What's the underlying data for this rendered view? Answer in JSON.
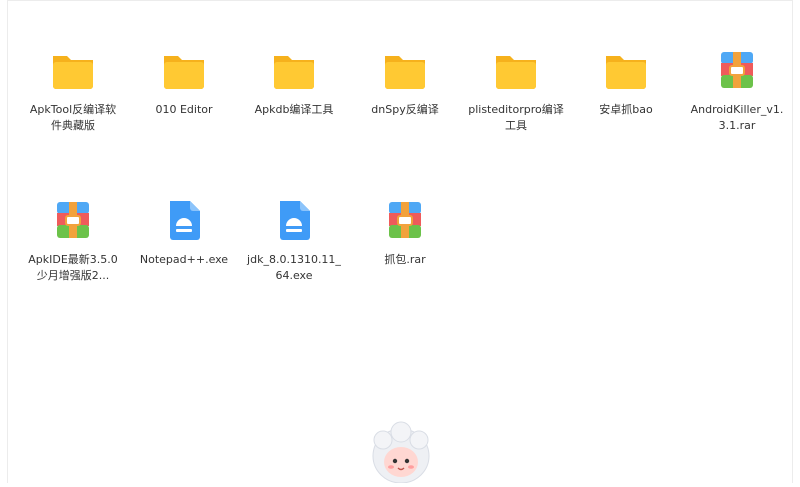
{
  "files": [
    {
      "name": "ApkTool反编译软件典藏版",
      "type": "folder"
    },
    {
      "name": "010 Editor",
      "type": "folder"
    },
    {
      "name": "Apkdb编译工具",
      "type": "folder"
    },
    {
      "name": "dnSpy反编译",
      "type": "folder"
    },
    {
      "name": "plisteditorpro编译工具",
      "type": "folder"
    },
    {
      "name": "安卓抓bao",
      "type": "folder"
    },
    {
      "name": "AndroidKiller_v1.3.1.rar",
      "type": "rar-archive"
    },
    {
      "name": "ApkIDE最新3.5.0少月增强版2...",
      "type": "rar-archive"
    },
    {
      "name": "Notepad++.exe",
      "type": "exe-file"
    },
    {
      "name": "jdk_8.0.1310.11_64.exe",
      "type": "exe-file"
    },
    {
      "name": "抓包.rar",
      "type": "rar-archive"
    }
  ],
  "colors": {
    "folder": "#ffc933",
    "folder_back": "#f6b11c",
    "exe": "#3f9bf7",
    "label_text": "#333333"
  }
}
